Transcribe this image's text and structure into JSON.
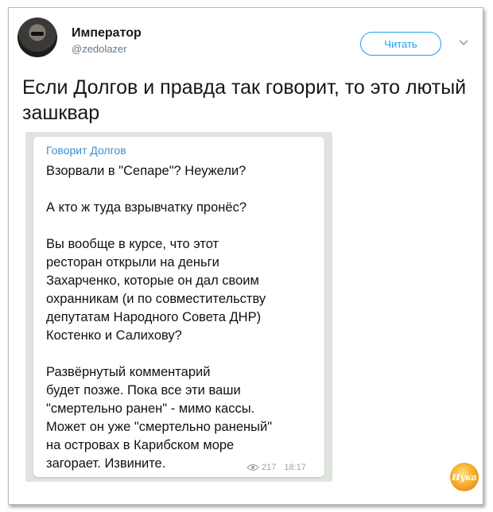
{
  "author": {
    "name": "Император",
    "handle": "@zedolazer"
  },
  "follow_button": {
    "label": "Читать"
  },
  "tweet": {
    "text": "Если Долгов и правда так говорит, то это лютый зашквар"
  },
  "screenshot": {
    "author": "Говорит Долгов",
    "message": "Взорвали в \"Сепаре\"? Неужели?\n\nА кто ж туда взрывчатку пронёс?\n\nВы вообще в курсе, что этот\nресторан открыли на деньги\nЗахарченко, которые он дал своим\nохранникам (и по совместительству\nдепутатам Народного Совета ДНР)\nКостенко и Салихову?\n\nРазвёрнутый комментарий\nбудет позже. Пока все эти ваши\n\"смертельно ранен\" - мимо кассы.\nМожет он уже \"смертельно раненый\"\nна островах в Карибском море\nзагорает. Извините.",
    "views": "217",
    "time": "18:17"
  },
  "icons": {
    "chevron": "chevron-down-icon",
    "views": "eye-icon"
  },
  "colors": {
    "accent": "#1da1f2",
    "telegram_author": "#3d8fd1"
  },
  "watermark": {
    "text": "Нука"
  }
}
